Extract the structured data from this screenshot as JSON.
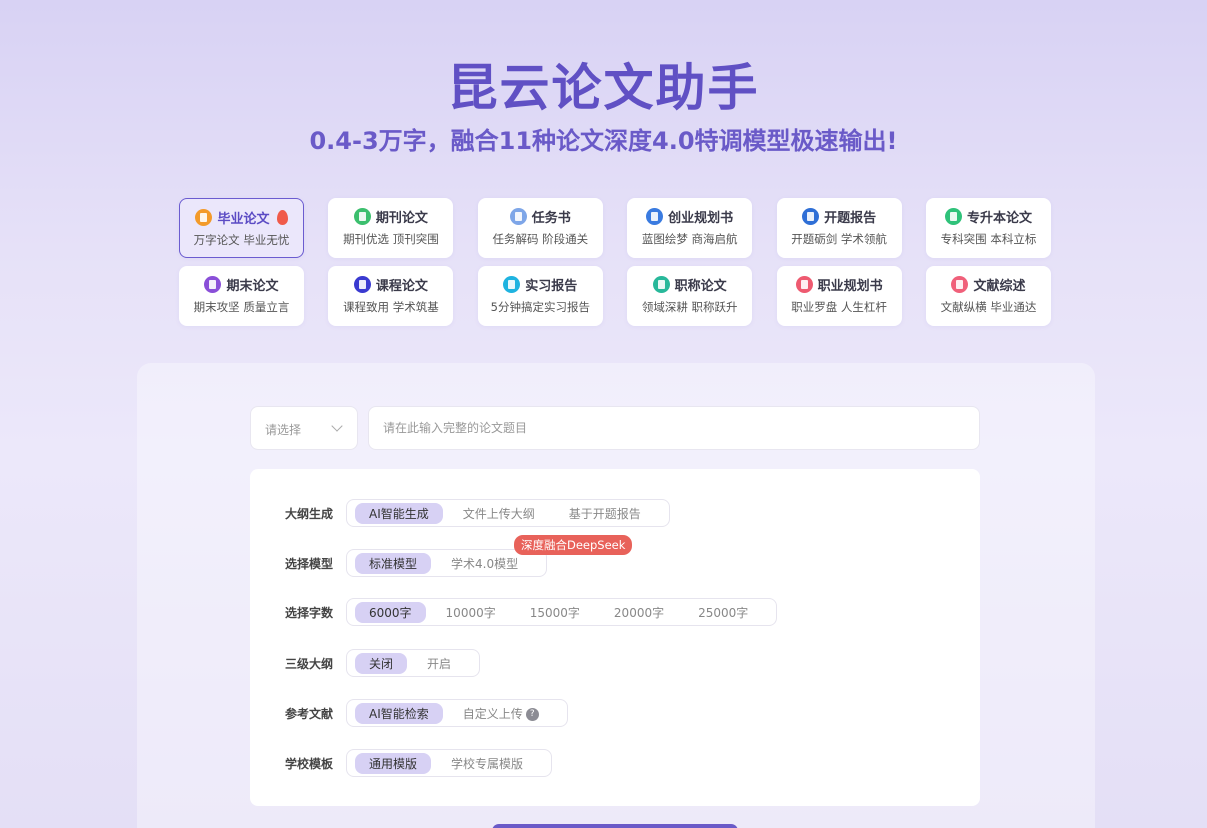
{
  "hero": {
    "title": "昆云论文助手",
    "subtitle": "0.4-3万字，融合11种论文深度4.0特调模型极速输出!"
  },
  "cards": [
    {
      "title": "毕业论文",
      "desc": "万字论文 毕业无忧",
      "icon": "doc-icon",
      "color": "#f39a2a",
      "active": true,
      "hot": true
    },
    {
      "title": "期刊论文",
      "desc": "期刊优选 顶刊突围",
      "icon": "doc-icon",
      "color": "#3cbf6e"
    },
    {
      "title": "任务书",
      "desc": "任务解码 阶段通关",
      "icon": "doc-icon",
      "color": "#7ea6e8"
    },
    {
      "title": "创业规划书",
      "desc": "蓝图绘梦 商海启航",
      "icon": "doc-icon",
      "color": "#3a7be0"
    },
    {
      "title": "开题报告",
      "desc": "开题砺剑 学术领航",
      "icon": "doc-icon",
      "color": "#2f6fd6"
    },
    {
      "title": "专升本论文",
      "desc": "专科突围 本科立标",
      "icon": "doc-icon",
      "color": "#2fc27a"
    },
    {
      "title": "期末论文",
      "desc": "期末攻坚 质量立言",
      "icon": "doc-icon",
      "color": "#8a4fd8"
    },
    {
      "title": "课程论文",
      "desc": "课程致用 学术筑基",
      "icon": "doc-icon",
      "color": "#3a3ad0"
    },
    {
      "title": "实习报告",
      "desc": "5分钟搞定实习报告",
      "icon": "doc-icon",
      "color": "#1fb3e0"
    },
    {
      "title": "职称论文",
      "desc": "领域深耕 职称跃升",
      "icon": "doc-icon",
      "color": "#28b89a"
    },
    {
      "title": "职业规划书",
      "desc": "职业罗盘 人生杠杆",
      "icon": "doc-icon",
      "color": "#ee5a70"
    },
    {
      "title": "文献综述",
      "desc": "文献纵横 毕业通达",
      "icon": "doc-icon",
      "color": "#f0607a"
    }
  ],
  "form": {
    "select_placeholder": "请选择",
    "topic_placeholder": "请在此输入完整的论文题目"
  },
  "options": [
    {
      "label": "大纲生成",
      "items": [
        "AI智能生成",
        "文件上传大纲",
        "基于开题报告"
      ],
      "selected": 0
    },
    {
      "label": "选择模型",
      "items": [
        "标准模型",
        "学术4.0模型"
      ],
      "selected": 0,
      "badge": "深度融合DeepSeek"
    },
    {
      "label": "选择字数",
      "items": [
        "6000字",
        "10000字",
        "15000字",
        "20000字",
        "25000字"
      ],
      "selected": 0
    },
    {
      "label": "三级大纲",
      "items": [
        "关闭",
        "开启"
      ],
      "selected": 0
    },
    {
      "label": "参考文献",
      "items": [
        "AI智能检索",
        "自定义上传"
      ],
      "selected": 0,
      "help": "?"
    },
    {
      "label": "学校模板",
      "items": [
        "通用模版",
        "学校专属模版"
      ],
      "selected": 0
    }
  ]
}
